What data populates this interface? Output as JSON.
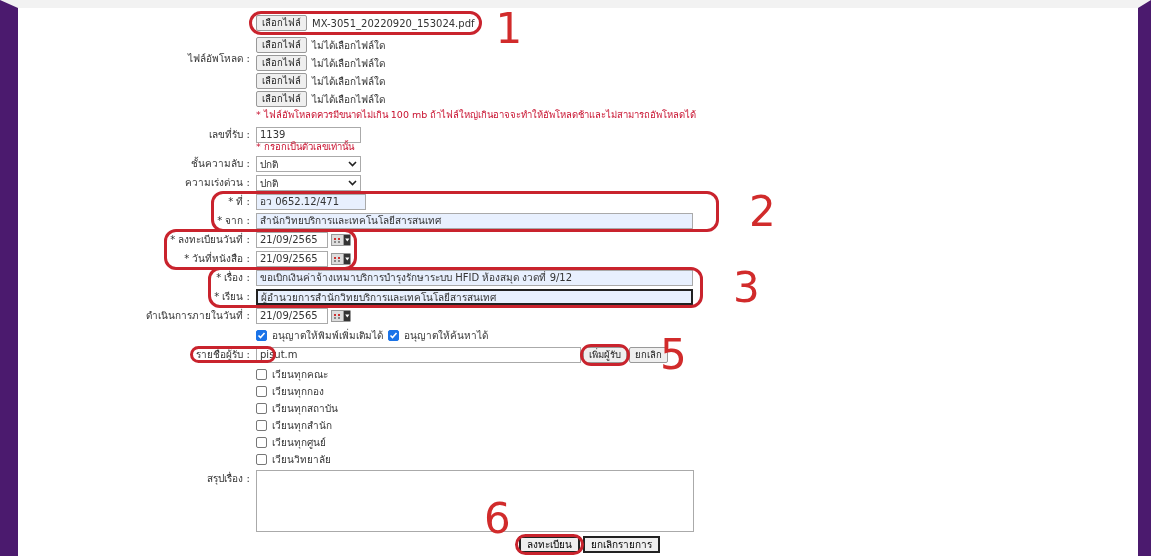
{
  "uploads": {
    "label": "ไฟล์อัพโหลด :",
    "files": [
      {
        "button": "เลือกไฟล์",
        "filename": "MX-3051_20220920_153024.pdf"
      },
      {
        "button": "เลือกไฟล์",
        "filename": "ไม่ได้เลือกไฟล์ใด"
      },
      {
        "button": "เลือกไฟล์",
        "filename": "ไม่ได้เลือกไฟล์ใด"
      },
      {
        "button": "เลือกไฟล์",
        "filename": "ไม่ได้เลือกไฟล์ใด"
      },
      {
        "button": "เลือกไฟล์",
        "filename": "ไม่ได้เลือกไฟล์ใด"
      }
    ],
    "note": "* ไฟล์อัพโหลดควรมีขนาดไม่เกิน 100 mb ถ้าไฟล์ใหญ่เกินอาจจะทำให้อัพโหลดช้าและไม่สามารถอัพโหลดได้"
  },
  "fields": [
    {
      "kind": "short",
      "label": "เลขที่รับ :",
      "value": "1139",
      "note": "* กรอกเป็นตัวเลขเท่านั้น",
      "autofilled": false,
      "focused": false
    },
    {
      "kind": "select",
      "label": "ชั้นความลับ :",
      "value": "ปกติ"
    },
    {
      "kind": "select",
      "label": "ความเร่งด่วน :",
      "value": "ปกติ"
    },
    {
      "kind": "short",
      "label": "* ที่ :",
      "value": "อว 0652.12/471",
      "autofilled": true,
      "focused": false
    },
    {
      "kind": "wide",
      "label": "* จาก :",
      "value": "สำนักวิทยบริการและเทคโนโลยีสารสนเทศ",
      "autofilled": true,
      "focused": false
    },
    {
      "kind": "date",
      "label": "* ลงทะเบียนวันที่ :",
      "value": "21/09/2565"
    },
    {
      "kind": "date",
      "label": "* วันที่หนังสือ :",
      "value": "21/09/2565"
    },
    {
      "kind": "wide",
      "label": "* เรื่อง :",
      "value": "ขอเบิกเงินค่าจ้างเหมาบริการบำรุงรักษาระบบ HFID ห้องสมุด งวดที่ 9/12",
      "autofilled": true,
      "focused": false
    },
    {
      "kind": "wide",
      "label": "* เรียน :",
      "value": "ผู้อำนวยการสำนักวิทยบริการและเทคโนโลยีสารสนเทศ",
      "autofilled": true,
      "focused": true
    },
    {
      "kind": "date",
      "label": "ดำเนินการภายในวันที่ :",
      "value": "21/09/2565"
    }
  ],
  "permissions": [
    {
      "label": "อนุญาตให้พิมพ์เพิ่มเติมได้",
      "checked": true
    },
    {
      "label": "อนุญาตให้ค้นหาได้",
      "checked": true
    }
  ],
  "recipients": {
    "label": "รายชื่อผู้รับ :",
    "value": "pisut.m",
    "buttons": [
      "เพิ่มผู้รับ",
      "ยกเลิก"
    ]
  },
  "circulate": [
    {
      "label": "เวียนทุกคณะ",
      "checked": false
    },
    {
      "label": "เวียนทุกกอง",
      "checked": false
    },
    {
      "label": "เวียนทุกสถาบัน",
      "checked": false
    },
    {
      "label": "เวียนทุกสำนัก",
      "checked": false
    },
    {
      "label": "เวียนทุกศูนย์",
      "checked": false
    },
    {
      "label": "เวียนวิทยาลัย",
      "checked": false
    }
  ],
  "summary": {
    "label": "สรุปเรื่อง :"
  },
  "actions": [
    "ลงทะเบียน",
    "ยกเลิกรายการ"
  ],
  "annotations": [
    "1",
    "2",
    "3",
    "5",
    "6"
  ]
}
